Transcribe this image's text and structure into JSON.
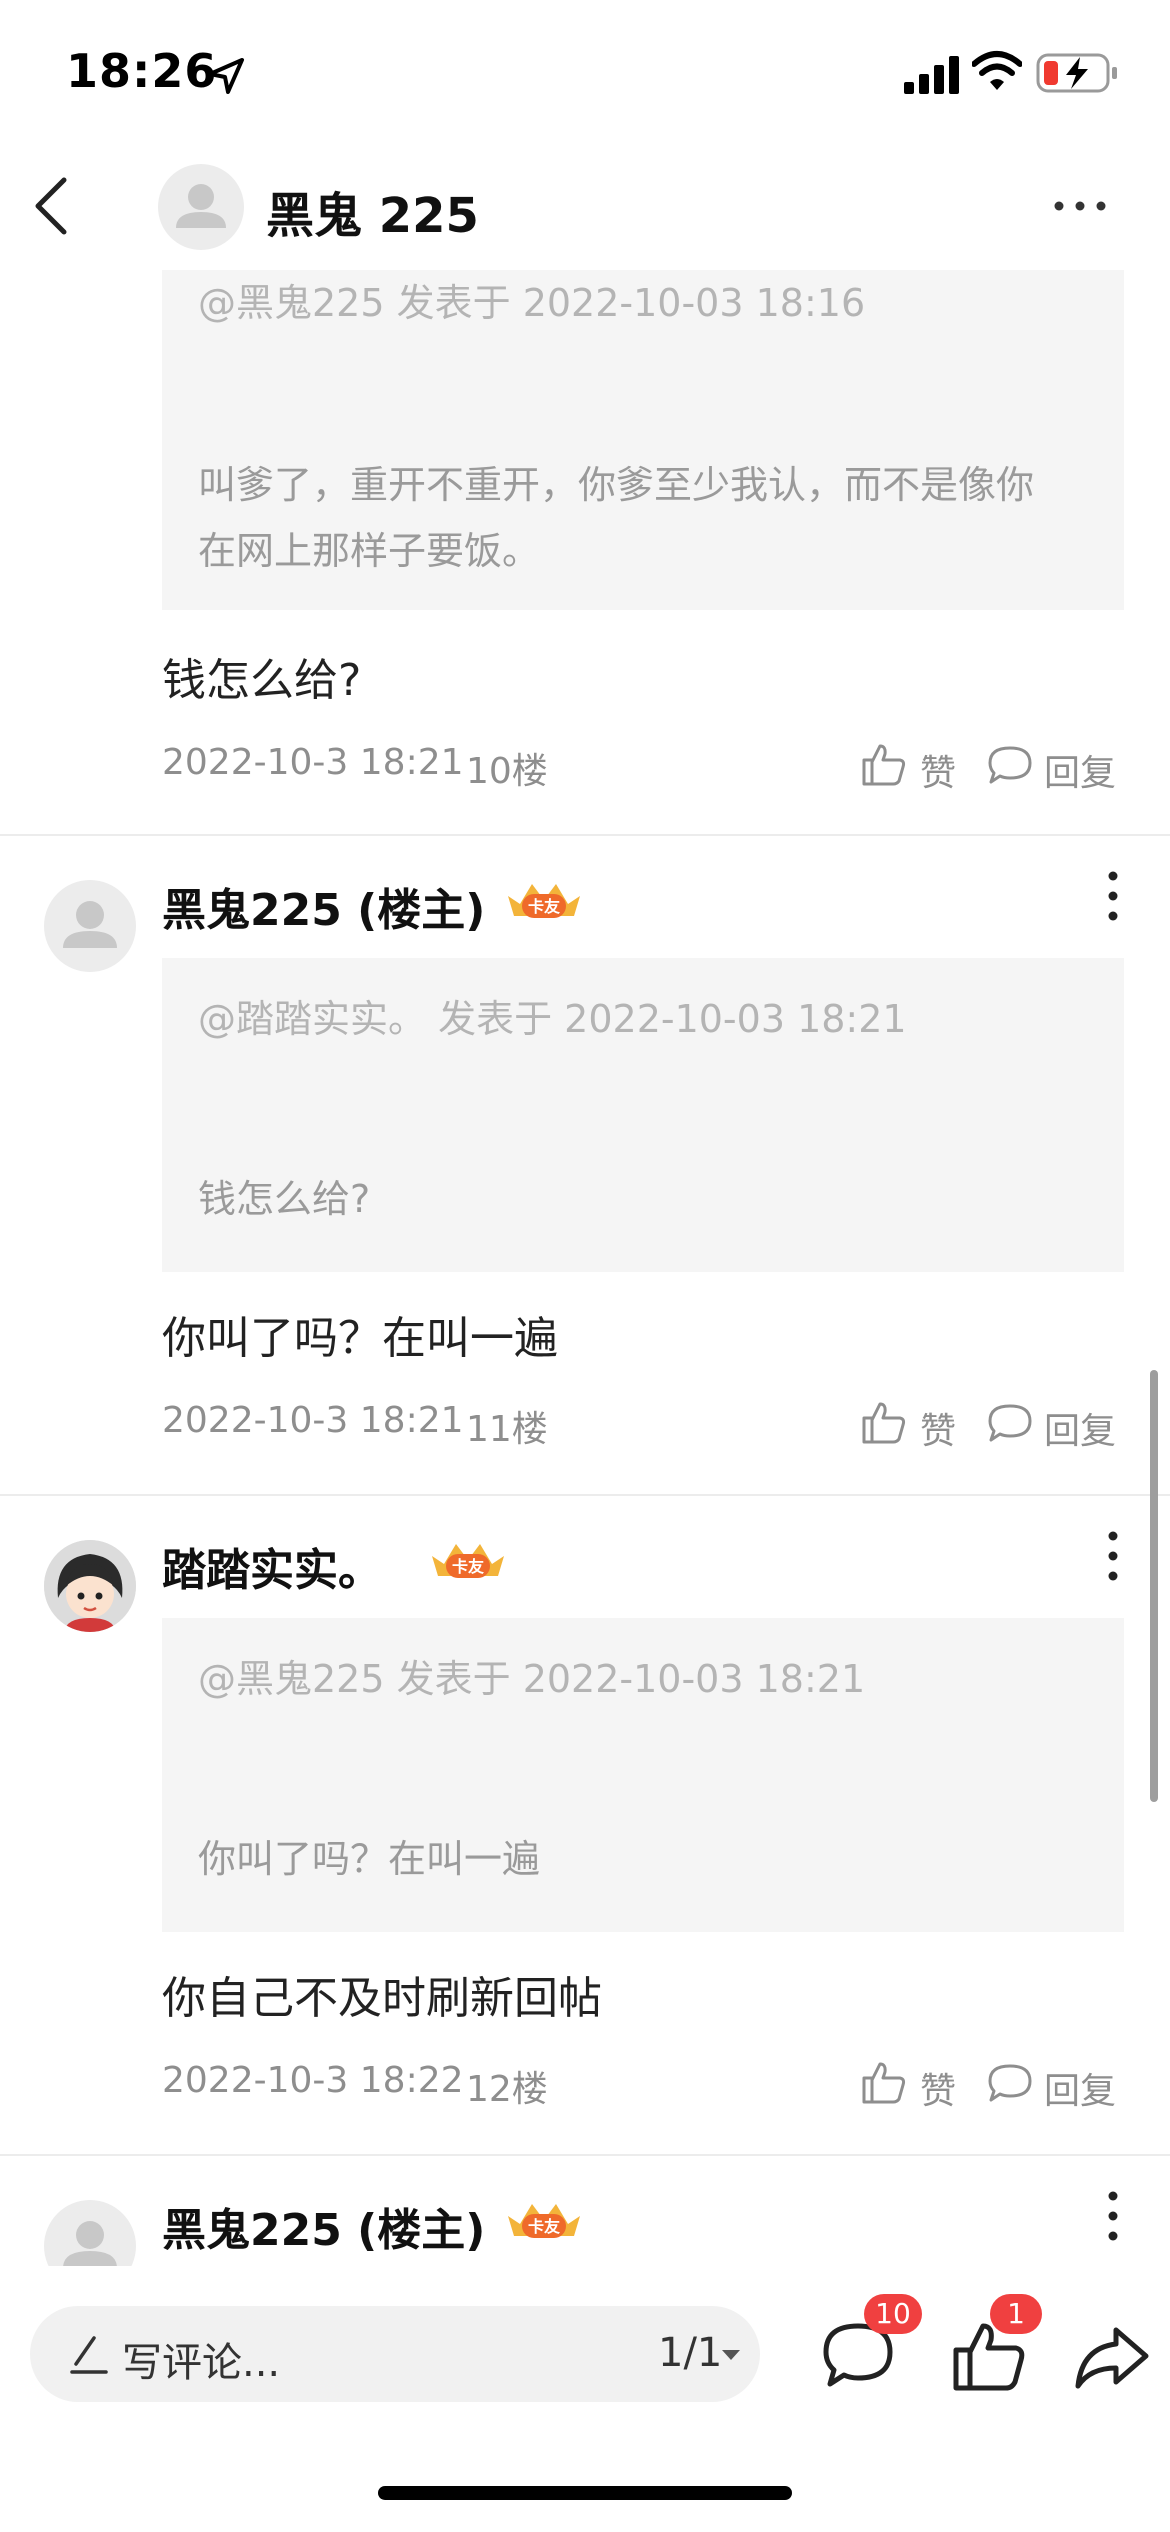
{
  "status_bar": {
    "time": "18:26"
  },
  "nav": {
    "title": "黑鬼 225"
  },
  "posts": [
    {
      "quote_head": "@黑鬼225 发表于 2022-10-03 18:16",
      "quote_body": "叫爹了，重开不重开，你爹至少我认，而不是像你在网上那样子要饭。",
      "text": "钱怎么给?",
      "time": "2022-10-3 18:21",
      "floor": "10楼",
      "like_label": "赞",
      "reply_label": "回复"
    },
    {
      "author": "黑鬼225 (楼主)",
      "badge": "卡友",
      "quote_head": "@踏踏实实。 发表于 2022-10-03 18:21",
      "quote_body": "钱怎么给?",
      "text": "你叫了吗？在叫一遍",
      "time": "2022-10-3 18:21",
      "floor": "11楼",
      "like_label": "赞",
      "reply_label": "回复"
    },
    {
      "author": "踏踏实实。",
      "badge": "卡友",
      "quote_head": "@黑鬼225 发表于 2022-10-03 18:21",
      "quote_body": "你叫了吗？在叫一遍",
      "text": "你自己不及时刷新回帖",
      "time": "2022-10-3 18:22",
      "floor": "12楼",
      "like_label": "赞",
      "reply_label": "回复"
    },
    {
      "author": "黑鬼225 (楼主)",
      "badge": "卡友"
    }
  ],
  "bottom_bar": {
    "comment_placeholder": "写评论...",
    "page_indicator": "1/1",
    "comment_count": "10",
    "like_count": "1"
  },
  "colors": {
    "badge_red": "#f04040",
    "badge_gold": "#f3b43a",
    "quote_bg": "#f5f5f5"
  }
}
